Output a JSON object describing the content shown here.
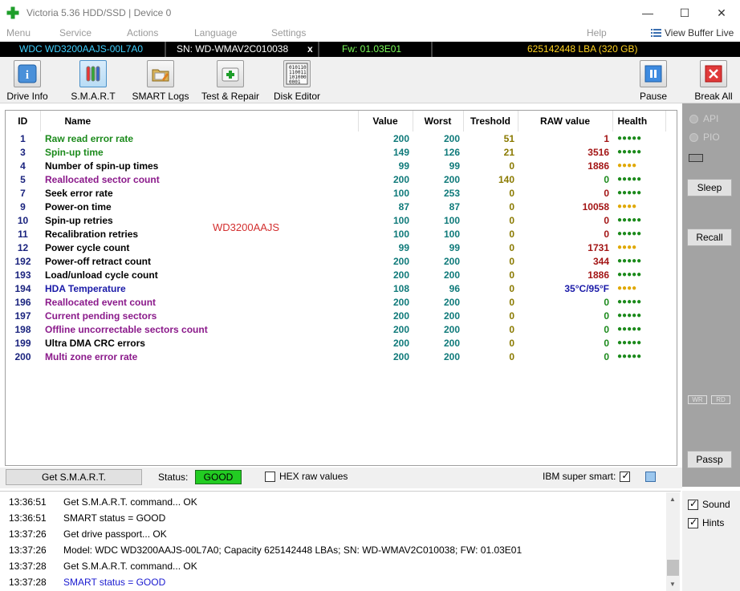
{
  "window": {
    "title": "Victoria 5.36 HDD/SSD | Device 0",
    "controls": [
      "—",
      "☐",
      "✕"
    ]
  },
  "menu": {
    "items": [
      "Menu",
      "Service",
      "Actions",
      "Language",
      "Settings",
      "Help"
    ],
    "view_buffer": "View Buffer Live"
  },
  "device": {
    "model": "WDC WD3200AAJS-00L7A0",
    "serial": "SN: WD-WMAV2C010038",
    "close": "x",
    "firmware": "Fw: 01.03E01",
    "capacity": "625142448 LBA (320 GB)"
  },
  "toolbar": {
    "drive_info": "Drive Info",
    "smart": "S.M.A.R.T",
    "smart_logs": "SMART Logs",
    "test_repair": "Test & Repair",
    "disk_editor": "Disk Editor",
    "pause": "Pause",
    "break_all": "Break All",
    "disk_editor_bits": [
      "010110",
      "110011",
      "101000",
      "0001"
    ]
  },
  "table": {
    "headers": {
      "id": "ID",
      "name": "Name",
      "value": "Value",
      "worst": "Worst",
      "treshold": "Treshold",
      "raw": "RAW value",
      "health": "Health"
    },
    "rows": [
      {
        "id": "1",
        "name": "Raw read error rate",
        "value": "200",
        "worst": "200",
        "thr": "51",
        "raw": "1",
        "health": "●●●●●",
        "name_color": "#1b8a1b",
        "raw_color": "#a31515",
        "health_color": "#1b8a1b"
      },
      {
        "id": "3",
        "name": "Spin-up time",
        "value": "149",
        "worst": "126",
        "thr": "21",
        "raw": "3516",
        "health": "●●●●●",
        "name_color": "#1b8a1b",
        "raw_color": "#a31515",
        "health_color": "#1b8a1b"
      },
      {
        "id": "4",
        "name": "Number of spin-up times",
        "value": "99",
        "worst": "99",
        "thr": "0",
        "raw": "1886",
        "health": "●●●●",
        "name_color": "#000000",
        "raw_color": "#a31515",
        "health_color": "#e0a800"
      },
      {
        "id": "5",
        "name": "Reallocated sector count",
        "value": "200",
        "worst": "200",
        "thr": "140",
        "raw": "0",
        "health": "●●●●●",
        "name_color": "#8b1a8b",
        "raw_color": "#1b8a1b",
        "health_color": "#1b8a1b"
      },
      {
        "id": "7",
        "name": "Seek error rate",
        "value": "100",
        "worst": "253",
        "thr": "0",
        "raw": "0",
        "health": "●●●●●",
        "name_color": "#000000",
        "raw_color": "#a31515",
        "health_color": "#1b8a1b"
      },
      {
        "id": "9",
        "name": "Power-on time",
        "value": "87",
        "worst": "87",
        "thr": "0",
        "raw": "10058",
        "health": "●●●●",
        "name_color": "#000000",
        "raw_color": "#a31515",
        "health_color": "#e0a800"
      },
      {
        "id": "10",
        "name": "Spin-up retries",
        "value": "100",
        "worst": "100",
        "thr": "0",
        "raw": "0",
        "health": "●●●●●",
        "name_color": "#000000",
        "raw_color": "#a31515",
        "health_color": "#1b8a1b"
      },
      {
        "id": "11",
        "name": "Recalibration retries",
        "value": "100",
        "worst": "100",
        "thr": "0",
        "raw": "0",
        "health": "●●●●●",
        "name_color": "#000000",
        "raw_color": "#a31515",
        "health_color": "#1b8a1b"
      },
      {
        "id": "12",
        "name": "Power cycle count",
        "value": "99",
        "worst": "99",
        "thr": "0",
        "raw": "1731",
        "health": "●●●●",
        "name_color": "#000000",
        "raw_color": "#a31515",
        "health_color": "#e0a800"
      },
      {
        "id": "192",
        "name": "Power-off retract count",
        "value": "200",
        "worst": "200",
        "thr": "0",
        "raw": "344",
        "health": "●●●●●",
        "name_color": "#000000",
        "raw_color": "#a31515",
        "health_color": "#1b8a1b"
      },
      {
        "id": "193",
        "name": "Load/unload cycle count",
        "value": "200",
        "worst": "200",
        "thr": "0",
        "raw": "1886",
        "health": "●●●●●",
        "name_color": "#000000",
        "raw_color": "#a31515",
        "health_color": "#1b8a1b"
      },
      {
        "id": "194",
        "name": "HDA Temperature",
        "value": "108",
        "worst": "96",
        "thr": "0",
        "raw": "35°C/95°F",
        "health": "●●●●",
        "name_color": "#1a1aa8",
        "raw_color": "#1a1aa8",
        "health_color": "#e0a800"
      },
      {
        "id": "196",
        "name": "Reallocated event count",
        "value": "200",
        "worst": "200",
        "thr": "0",
        "raw": "0",
        "health": "●●●●●",
        "name_color": "#8b1a8b",
        "raw_color": "#1b8a1b",
        "health_color": "#1b8a1b"
      },
      {
        "id": "197",
        "name": "Current pending sectors",
        "value": "200",
        "worst": "200",
        "thr": "0",
        "raw": "0",
        "health": "●●●●●",
        "name_color": "#8b1a8b",
        "raw_color": "#1b8a1b",
        "health_color": "#1b8a1b"
      },
      {
        "id": "198",
        "name": "Offline uncorrectable sectors count",
        "value": "200",
        "worst": "200",
        "thr": "0",
        "raw": "0",
        "health": "●●●●●",
        "name_color": "#8b1a8b",
        "raw_color": "#1b8a1b",
        "health_color": "#1b8a1b"
      },
      {
        "id": "199",
        "name": "Ultra DMA CRC errors",
        "value": "200",
        "worst": "200",
        "thr": "0",
        "raw": "0",
        "health": "●●●●●",
        "name_color": "#000000",
        "raw_color": "#1b8a1b",
        "health_color": "#1b8a1b"
      },
      {
        "id": "200",
        "name": "Multi zone error rate",
        "value": "200",
        "worst": "200",
        "thr": "0",
        "raw": "0",
        "health": "●●●●●",
        "name_color": "#8b1a8b",
        "raw_color": "#1b8a1b",
        "health_color": "#1b8a1b"
      }
    ],
    "watermark": "WD3200AAJS"
  },
  "status": {
    "get_smart": "Get S.M.A.R.T.",
    "status_label": "Status:",
    "status_value": "GOOD",
    "hex_raw": "HEX raw values",
    "ibm_super_smart": "IBM super smart:"
  },
  "log": [
    {
      "time": "13:36:51",
      "text": "Get S.M.A.R.T. command... OK",
      "color": "#000000"
    },
    {
      "time": "13:36:51",
      "text": "SMART status = GOOD",
      "color": "#000000"
    },
    {
      "time": "13:37:26",
      "text": "Get drive passport... OK",
      "color": "#000000"
    },
    {
      "time": "13:37:26",
      "text": "Model: WDC WD3200AAJS-00L7A0; Capacity 625142448 LBAs; SN: WD-WMAV2C010038; FW: 01.03E01",
      "color": "#000000"
    },
    {
      "time": "13:37:28",
      "text": "Get S.M.A.R.T. command... OK",
      "color": "#000000"
    },
    {
      "time": "13:37:28",
      "text": "SMART status = GOOD",
      "color": "#1a1ad0"
    }
  ],
  "side": {
    "api": "API",
    "pio": "PIO",
    "sleep": "Sleep",
    "recall": "Recall",
    "wr": "WR",
    "rd": "RD",
    "passp": "Passp",
    "sound": "Sound",
    "hints": "Hints"
  },
  "colors": {
    "value_color": "#0f7a7a",
    "thr_color": "#8a7a00",
    "good_bg": "#22cc22"
  }
}
